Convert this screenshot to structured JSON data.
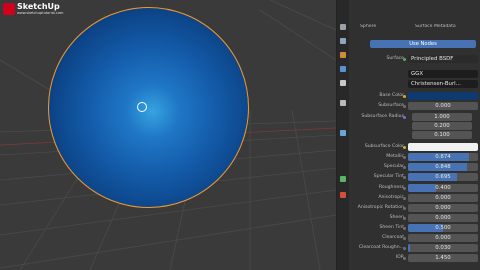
{
  "app": {
    "brand": "SketchUp",
    "brand_site": "www.sketchuptutorial.com"
  },
  "header": {
    "tab_left": "Sphere",
    "tab_right": "Surface Metadata",
    "use_nodes_label": "Use Nodes"
  },
  "surface": {
    "label": "Surface",
    "shader": "Principled BSDF",
    "distribution": "GGX",
    "subsurface_method": "Christensen-Burl..."
  },
  "properties": [
    {
      "label": "Base Color",
      "kind": "swatch",
      "color": "#0e3a70"
    },
    {
      "label": "Subsurface",
      "value": "0.000",
      "fill": 0
    },
    {
      "label": "Subsurface Radius",
      "kind": "vector",
      "values": [
        "1.000",
        "0.200",
        "0.100"
      ]
    },
    {
      "label": "Subsurface Color",
      "kind": "swatch",
      "color": "#f2f2f2"
    },
    {
      "label": "Metallic",
      "value": "0.874",
      "fill": 0.874
    },
    {
      "label": "Specular",
      "value": "0.848",
      "fill": 0.848
    },
    {
      "label": "Specular Tint",
      "value": "0.695",
      "fill": 0.695
    },
    {
      "label": "Roughness",
      "value": "0.400",
      "fill": 0.4
    },
    {
      "label": "Anisotropic",
      "value": "0.000",
      "fill": 0
    },
    {
      "label": "Anisotropic Rotation",
      "value": "0.000",
      "fill": 0
    },
    {
      "label": "Sheen",
      "value": "0.000",
      "fill": 0
    },
    {
      "label": "Sheen Tint",
      "value": "0.500",
      "fill": 0.5
    },
    {
      "label": "Clearcoat",
      "value": "0.000",
      "fill": 0
    },
    {
      "label": "Clearcoat Roughn...",
      "value": "0.030",
      "fill": 0.03
    },
    {
      "label": "IOR",
      "value": "1.450",
      "fill": 0
    }
  ],
  "colors": {
    "selection_outline": "#f29a2e",
    "accent": "#4772b3",
    "sphere_blue": "#135aa8"
  },
  "tab_icons": [
    "scene-icon",
    "world-icon",
    "object-icon",
    "modifier-icon",
    "particles-icon",
    "physics-icon",
    "constraints-icon",
    "data-icon",
    "material-icon"
  ]
}
